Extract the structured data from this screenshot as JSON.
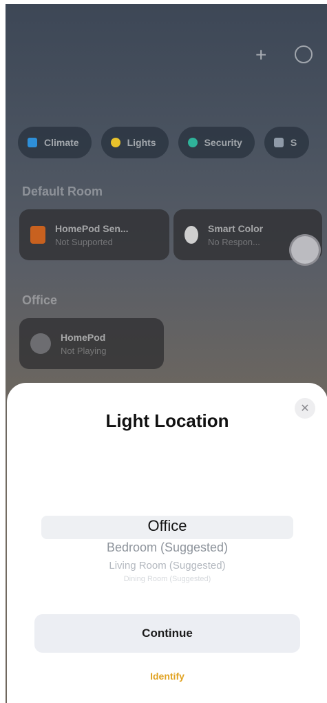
{
  "toolbar": {
    "add_icon": "plus-icon",
    "more_icon": "ellipsis-circle-icon",
    "add_glyph": "+"
  },
  "categories": [
    {
      "label": "Climate",
      "icon": "climate-icon",
      "color": "#2e8fd8"
    },
    {
      "label": "Lights",
      "icon": "lightbulb-icon",
      "color": "#e8c22c"
    },
    {
      "label": "Security",
      "icon": "security-icon",
      "color": "#2fb39a"
    },
    {
      "label": "S",
      "icon": "speaker-icon",
      "color": "#8f9aa8"
    }
  ],
  "rooms": {
    "default_room": {
      "title": "Default Room",
      "tiles": [
        {
          "name": "HomePod Sen...",
          "status": "Not Supported"
        },
        {
          "name": "Smart Color",
          "status": "No Respon..."
        }
      ]
    },
    "office": {
      "title": "Office",
      "tiles": [
        {
          "name": "HomePod",
          "status": "Not Playing"
        }
      ]
    }
  },
  "sheet": {
    "title": "Light Location",
    "close_glyph": "✕",
    "picker": {
      "selected": "Office",
      "options": [
        "Bedroom (Suggested)",
        "Living Room (Suggested)",
        "Dining Room (Suggested)"
      ]
    },
    "continue_label": "Continue",
    "identify_label": "Identify",
    "accent_color": "#e1a323"
  }
}
